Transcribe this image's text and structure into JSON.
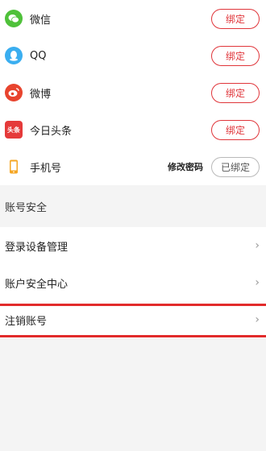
{
  "bindings": [
    {
      "name": "微信",
      "button": "绑定",
      "icon": "wechat-icon",
      "color": "#4fc13a"
    },
    {
      "name": "QQ",
      "button": "绑定",
      "icon": "qq-icon",
      "color": "#3aaef0"
    },
    {
      "name": "微博",
      "button": "绑定",
      "icon": "weibo-icon",
      "color": "#e8442e"
    },
    {
      "name": "今日头条",
      "button": "绑定",
      "icon": "toutiao-icon",
      "color": "#e53a3a",
      "icon_text": "头条"
    },
    {
      "name": "手机号",
      "button": "已绑定",
      "extra": "修改密码",
      "icon": "phone-icon",
      "color": "#f5a623"
    }
  ],
  "security": {
    "title": "账号安全",
    "items": [
      {
        "label": "登录设备管理"
      },
      {
        "label": "账户安全中心"
      },
      {
        "label": "注销账号"
      }
    ],
    "chevron": "›"
  },
  "accent_color": "#e0353a"
}
